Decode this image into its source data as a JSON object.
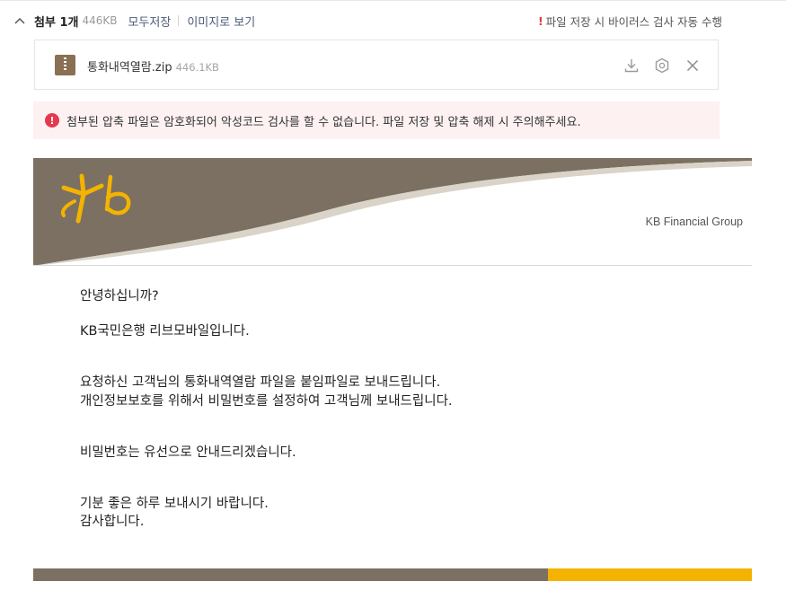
{
  "attachments": {
    "label": "첨부 1개",
    "total_size": "446KB",
    "save_all": "모두저장",
    "view_as_image": "이미지로 보기",
    "notice": "파일 저장 시 바이러스 검사 자동 수행",
    "notice_mark": "!",
    "file": {
      "name": "통화내역열람.zip",
      "size": "446.1KB"
    },
    "warning": "첨부된 압축 파일은 암호화되어 악성코드 검사를 할 수 없습니다. 파일 저장 및 압축 해제 시 주의해주세요.",
    "warning_mark": "!"
  },
  "mail": {
    "brand_text": "KB Financial Group",
    "greeting": "안녕하십니까?",
    "intro": "KB국민은행 리브모바일입니다.",
    "line1": "요청하신 고객님의 통화내역열람 파일을 붙임파일로 보내드립니다.",
    "line2": "개인정보보호를 위해서 비밀번호를 설정하여 고객님께 보내드립니다.",
    "line3": "비밀번호는 유선으로 안내드리겠습니다.",
    "line4": "기분 좋은 하루 보내시기 바랍니다.",
    "line5": "감사합니다."
  },
  "colors": {
    "kb_brown": "#7b7061",
    "kb_yellow": "#f4b301",
    "warning_bg": "#fdf1f2",
    "warning_red": "#e53950",
    "link_blue": "#4b5b78"
  },
  "icons": {
    "collapse": "chevron-up-icon",
    "file": "zip-file-icon",
    "download": "download-icon",
    "scan": "shield-icon",
    "close": "close-icon",
    "logo": "kb-logo-icon"
  }
}
